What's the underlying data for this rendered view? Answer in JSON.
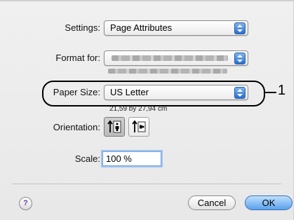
{
  "settings": {
    "label": "Settings:",
    "value": "Page Attributes"
  },
  "format_for": {
    "label": "Format for:"
  },
  "paper_size": {
    "label": "Paper Size:",
    "value": "US Letter",
    "dimensions": "21,59 by 27,94 cm"
  },
  "orientation": {
    "label": "Orientation:",
    "options": [
      "portrait-icon",
      "landscape-icon"
    ],
    "selected": "portrait-icon"
  },
  "scale": {
    "label": "Scale:",
    "value": "100 %"
  },
  "callout": {
    "number": "1"
  },
  "buttons": {
    "help": "?",
    "cancel": "Cancel",
    "ok": "OK"
  },
  "colors": {
    "accent": "#5aa0ea",
    "popup_arrow": "#2a6fd0"
  }
}
